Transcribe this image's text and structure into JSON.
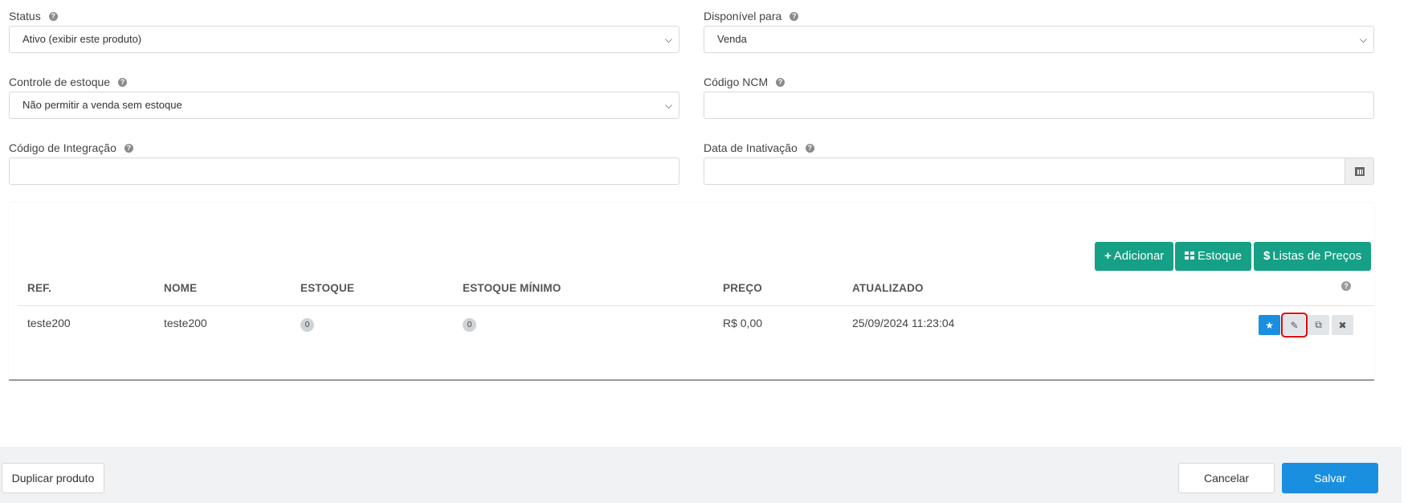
{
  "fields": {
    "status": {
      "label": "Status",
      "value": "Ativo (exibir este produto)"
    },
    "disponivel": {
      "label": "Disponível para",
      "value": "Venda"
    },
    "controle_estoque": {
      "label": "Controle de estoque",
      "value": "Não permitir a venda sem estoque"
    },
    "codigo_ncm": {
      "label": "Código NCM",
      "value": ""
    },
    "codigo_integracao": {
      "label": "Código de Integração",
      "value": ""
    },
    "data_inativacao": {
      "label": "Data de Inativação",
      "value": ""
    }
  },
  "help_glyph": "?",
  "variants": {
    "buttons": {
      "add": "Adicionar",
      "stock": "Estoque",
      "price_lists": "Listas de Preços"
    },
    "columns": [
      "REF.",
      "NOME",
      "ESTOQUE",
      "ESTOQUE MÍNIMO",
      "PREÇO",
      "ATUALIZADO"
    ],
    "rows": [
      {
        "ref": "teste200",
        "nome": "teste200",
        "estoque": "0",
        "estoque_minimo": "0",
        "preco": "R$ 0,00",
        "atualizado": "25/09/2024 11:23:04"
      }
    ],
    "row_actions": [
      "star-icon",
      "pencil-icon",
      "copy-icon",
      "close-icon"
    ]
  },
  "footer": {
    "duplicate": "Duplicar produto",
    "cancel": "Cancelar",
    "save": "Salvar"
  },
  "colors": {
    "green": "#16a085",
    "blue": "#1a8fe0",
    "focus_outline": "#e00000"
  }
}
